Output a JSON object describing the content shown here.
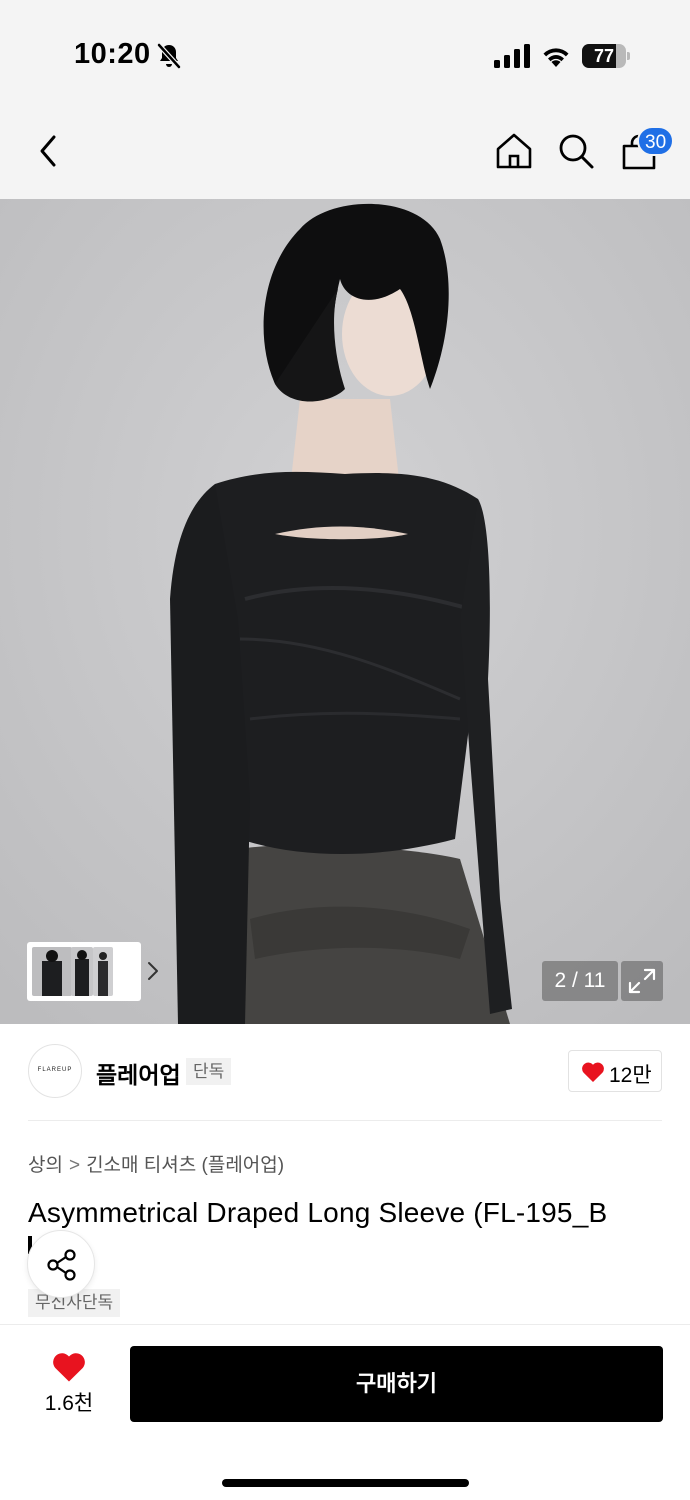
{
  "status_bar": {
    "time": "10:20",
    "battery": "77",
    "battery_level": 0.77
  },
  "nav": {
    "cart_count": "30",
    "icons": [
      "back-icon",
      "home-icon",
      "search-icon",
      "cart-icon"
    ]
  },
  "gallery": {
    "counter": "2 / 11",
    "thumbnails": 3
  },
  "brand": {
    "logo_text": "FLAREUP",
    "name": "플레어업",
    "tag": "단독",
    "likes": "12만"
  },
  "breadcrumb": {
    "category": "상의",
    "separator": ">",
    "subcategory": "긴소매 티셔츠 (플레어업)"
  },
  "product": {
    "title": "Asymmetrical Draped Long Sleeve (FL-195_B",
    "tag": "무신사단독"
  },
  "bottom": {
    "likes": "1.6천",
    "buy_label": "구매하기"
  },
  "colors": {
    "badge_blue": "#1f6fe6",
    "heart_red": "#e8131f",
    "buy_button": "#000000"
  }
}
